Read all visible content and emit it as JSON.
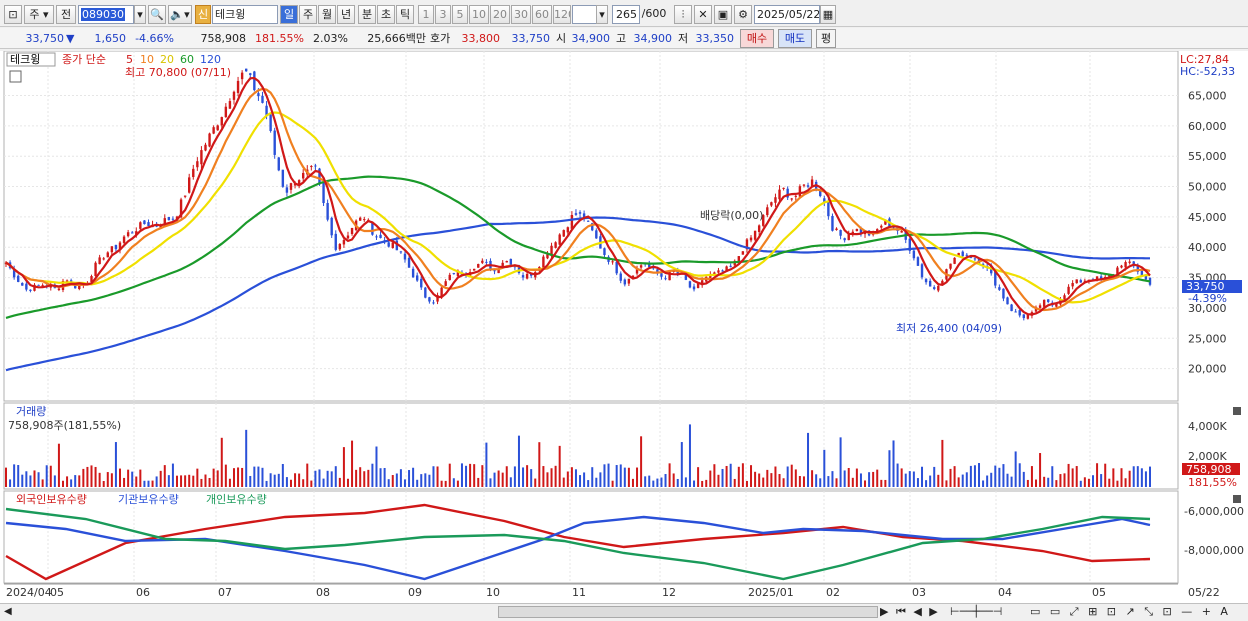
{
  "toolbar": {
    "market_label": "주",
    "prev_label": "전",
    "code": "089030",
    "new_badge": "신",
    "stock_name": "테크윙",
    "periods": [
      "일",
      "주",
      "월",
      "년",
      "분",
      "초",
      "틱"
    ],
    "active_period": "일",
    "intervals": [
      "1",
      "3",
      "5",
      "10",
      "20",
      "30",
      "60",
      "120"
    ],
    "count": "265",
    "count_max": "/600",
    "date": "2025/05/22"
  },
  "quote": {
    "price": "33,750",
    "change_arrow": "▼",
    "change": "1,650",
    "change_pct": "-4.66%",
    "volume": "758,908",
    "volume_ratio": "181.55%",
    "turnover": "2.03%",
    "amount": "25,666백만",
    "bid_label": "호가",
    "bid": "33,800",
    "ask": "33,750",
    "open_label": "시",
    "open": "34,900",
    "high_label": "고",
    "high": "34,900",
    "low_label": "저",
    "low": "33,350",
    "buy_button": "매수",
    "sell_button": "매도",
    "flat_button": "평"
  },
  "price_panel": {
    "name": "테크윙",
    "legend_price": "종가 단순",
    "ma_periods": [
      "5",
      "10",
      "20",
      "60",
      "120"
    ],
    "ma_colors": [
      "#d01818",
      "#f08020",
      "#f0e000",
      "#1a9a2a",
      "#2a50d8"
    ],
    "high_annotation": "최고 70,800 (07/11)",
    "low_annotation": "최저 26,400 (04/09)",
    "dividend_annotation": "배당락(0,00)",
    "lc": "LC:27,84",
    "hc": "HC:-52,33",
    "current_price": "33,750",
    "current_change": "-4.39%",
    "y_ticks": [
      "65,000",
      "60,000",
      "55,000",
      "50,000",
      "45,000",
      "40,000",
      "35,000",
      "30,000",
      "25,000",
      "20,000"
    ]
  },
  "volume_panel": {
    "title": "거래량",
    "value_label": "758,908주(181,55%)",
    "y_ticks": [
      "4,000K",
      "2,000K"
    ],
    "current_value": "758,908",
    "current_ratio": "181,55%"
  },
  "holding_panel": {
    "legend": [
      "외국인보유수량",
      "기관보유수량",
      "개인보유수량"
    ],
    "colors": [
      "#d01818",
      "#2a50d8",
      "#1a9a5a"
    ],
    "y_ticks": [
      "-6,000,000",
      "-8,000,000"
    ]
  },
  "x_axis": {
    "labels": [
      "2024/04",
      "05",
      "06",
      "07",
      "08",
      "09",
      "10",
      "11",
      "12",
      "2025/01",
      "02",
      "03",
      "04",
      "05",
      "05/22"
    ]
  },
  "chart_data": {
    "type": "candlestick",
    "title": "테크윙",
    "x_start": "2024/04",
    "x_end": "2025/05/22",
    "ylim": [
      15000,
      72000
    ],
    "close_path": [
      [
        0,
        37500
      ],
      [
        10,
        35000
      ],
      [
        20,
        33000
      ],
      [
        30,
        33500
      ],
      [
        40,
        34000
      ],
      [
        50,
        33000
      ],
      [
        60,
        35000
      ],
      [
        70,
        33500
      ],
      [
        80,
        34000
      ],
      [
        90,
        37000
      ],
      [
        100,
        39000
      ],
      [
        110,
        40000
      ],
      [
        120,
        42000
      ],
      [
        130,
        43000
      ],
      [
        140,
        44000
      ],
      [
        150,
        43500
      ],
      [
        160,
        44500
      ],
      [
        170,
        45000
      ],
      [
        180,
        49000
      ],
      [
        190,
        54000
      ],
      [
        200,
        57000
      ],
      [
        210,
        60000
      ],
      [
        220,
        63000
      ],
      [
        230,
        67000
      ],
      [
        240,
        69000
      ],
      [
        250,
        66000
      ],
      [
        260,
        63000
      ],
      [
        270,
        55000
      ],
      [
        280,
        49000
      ],
      [
        290,
        51000
      ],
      [
        300,
        52000
      ],
      [
        310,
        53000
      ],
      [
        320,
        46000
      ],
      [
        330,
        40000
      ],
      [
        340,
        41500
      ],
      [
        350,
        44000
      ],
      [
        360,
        45000
      ],
      [
        370,
        42000
      ],
      [
        380,
        41000
      ],
      [
        390,
        40000
      ],
      [
        400,
        38000
      ],
      [
        410,
        35000
      ],
      [
        420,
        32000
      ],
      [
        430,
        31000
      ],
      [
        440,
        34000
      ],
      [
        450,
        36000
      ],
      [
        460,
        35500
      ],
      [
        470,
        37000
      ],
      [
        480,
        37500
      ],
      [
        490,
        36000
      ],
      [
        500,
        38000
      ],
      [
        510,
        37000
      ],
      [
        520,
        35000
      ],
      [
        530,
        36000
      ],
      [
        540,
        38500
      ],
      [
        550,
        41000
      ],
      [
        560,
        43000
      ],
      [
        570,
        45500
      ],
      [
        580,
        45000
      ],
      [
        590,
        42000
      ],
      [
        600,
        39000
      ],
      [
        610,
        37000
      ],
      [
        620,
        34000
      ],
      [
        630,
        36000
      ],
      [
        640,
        37500
      ],
      [
        650,
        36000
      ],
      [
        660,
        35000
      ],
      [
        670,
        36000
      ],
      [
        680,
        35000
      ],
      [
        690,
        32500
      ],
      [
        700,
        35000
      ],
      [
        710,
        35500
      ],
      [
        720,
        36000
      ],
      [
        730,
        37000
      ],
      [
        740,
        40000
      ],
      [
        750,
        42000
      ],
      [
        760,
        45000
      ],
      [
        770,
        48000
      ],
      [
        780,
        49500
      ],
      [
        790,
        48000
      ],
      [
        800,
        50000
      ],
      [
        810,
        51000
      ],
      [
        820,
        48000
      ],
      [
        830,
        43000
      ],
      [
        840,
        41500
      ],
      [
        850,
        43000
      ],
      [
        860,
        42500
      ],
      [
        870,
        42000
      ],
      [
        880,
        44000
      ],
      [
        890,
        43500
      ],
      [
        900,
        42000
      ],
      [
        910,
        39000
      ],
      [
        920,
        35000
      ],
      [
        930,
        33000
      ],
      [
        940,
        35000
      ],
      [
        950,
        38000
      ],
      [
        960,
        39000
      ],
      [
        970,
        38500
      ],
      [
        980,
        37500
      ],
      [
        990,
        35000
      ],
      [
        1000,
        32000
      ],
      [
        1010,
        29500
      ],
      [
        1020,
        28500
      ],
      [
        1030,
        29000
      ],
      [
        1040,
        31000
      ],
      [
        1050,
        30500
      ],
      [
        1060,
        32000
      ],
      [
        1070,
        34000
      ],
      [
        1080,
        34500
      ],
      [
        1090,
        35000
      ],
      [
        1100,
        34500
      ],
      [
        1110,
        35500
      ],
      [
        1120,
        37500
      ],
      [
        1130,
        37000
      ],
      [
        1140,
        35500
      ],
      [
        1148,
        33750
      ]
    ],
    "series": [
      {
        "name": "5",
        "color": "#d01818"
      },
      {
        "name": "10",
        "color": "#f08020"
      },
      {
        "name": "20",
        "color": "#f0e000"
      },
      {
        "name": "60",
        "color": "#1a9a2a"
      },
      {
        "name": "120",
        "color": "#2a50d8"
      }
    ]
  }
}
